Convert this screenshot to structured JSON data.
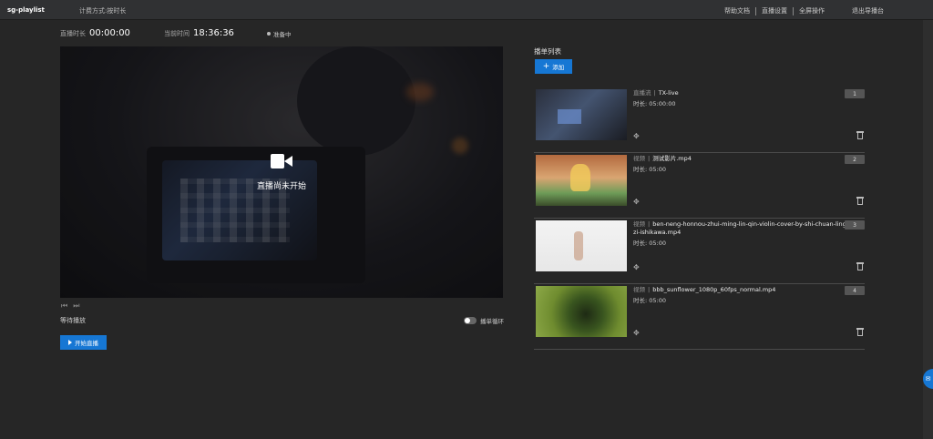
{
  "header": {
    "app_title": "sg-playlist",
    "billing_label": "计费方式:",
    "billing_value": "按时长",
    "nav": [
      "帮助文档",
      "直播设置",
      "全屏操作"
    ],
    "exit_label": "退出导播台"
  },
  "stats": {
    "live_duration_label": "直播时长",
    "live_duration_value": "00:00:00",
    "current_time_label": "当前时间",
    "current_time_value": "18:36:36",
    "status_text": "准备中"
  },
  "player": {
    "message": "直播尚未开始",
    "wait_text": "等待播放",
    "loop_label": "播单循环",
    "loop_enabled": false,
    "start_label": "开始直播"
  },
  "playlist": {
    "title": "播单列表",
    "add_label": "添加",
    "items": [
      {
        "type": "直播流",
        "name": "TX-live",
        "duration_label": "时长:",
        "duration": "05:00:00",
        "index": "1"
      },
      {
        "type": "视频",
        "name": "测试影片.mp4",
        "duration_label": "时长:",
        "duration": "05:00",
        "index": "2"
      },
      {
        "type": "视频",
        "name": "ben-neng-honnou-zhui-ming-lin-qin-violin-cover-by-shi-chuan-ling-zi-ishikawa.mp4",
        "duration_label": "时长:",
        "duration": "05:00",
        "index": "3"
      },
      {
        "type": "视频",
        "name": "bbb_sunflower_1080p_60fps_normal.mp4",
        "duration_label": "时长:",
        "duration": "05:00",
        "index": "4"
      }
    ]
  },
  "colors": {
    "accent": "#1677d4",
    "background": "#262626",
    "topbar": "#303133"
  }
}
